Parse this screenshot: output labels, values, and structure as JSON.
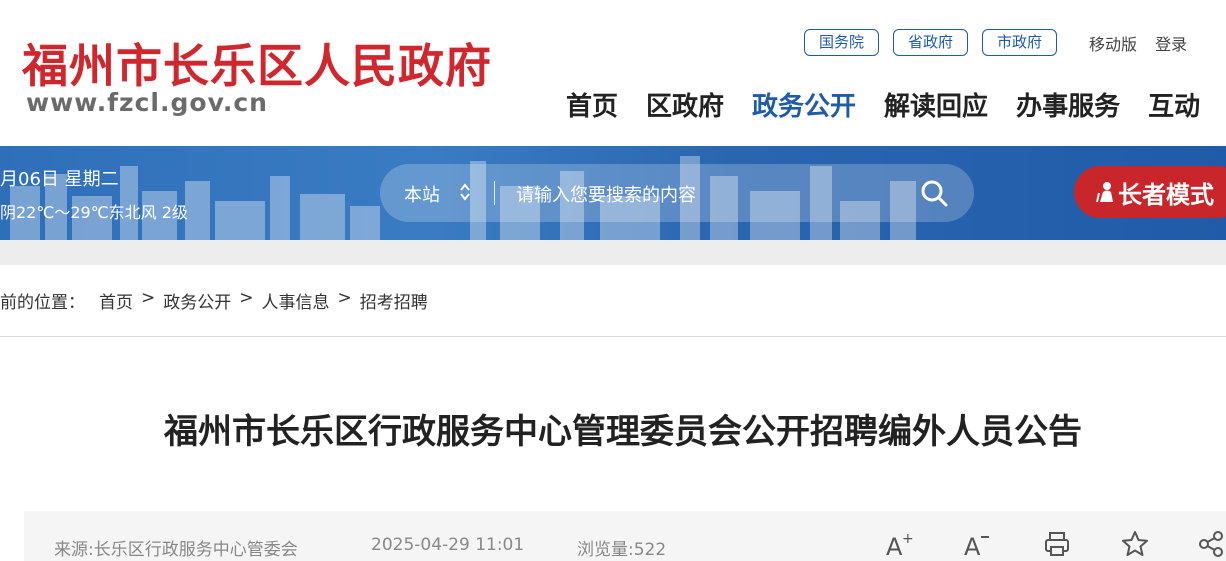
{
  "header": {
    "site_title": "福州市长乐区人民政府",
    "site_url": "www.fzcl.gov.cn",
    "top_links": {
      "guowuyuan": "国务院",
      "shengzhengfu": "省政府",
      "shizhengfu": "市政府",
      "mobile": "移动版",
      "login": "登录"
    },
    "nav": [
      "首页",
      "区政府",
      "政务公开",
      "解读回应",
      "办事服务",
      "互动"
    ],
    "active_nav_index": 2
  },
  "banner": {
    "date": "月06日 星期二",
    "weather": "阴22℃～29℃东北风 2级",
    "search_scope": "本站",
    "search_placeholder": "请输入您要搜索的内容",
    "elder_mode": "长者模式"
  },
  "breadcrumb": {
    "label": "前的位置：",
    "items": [
      "首页",
      "政务公开",
      "人事信息",
      "招考招聘"
    ],
    "separator": ">"
  },
  "article": {
    "title": "福州市长乐区行政服务中心管理委员会公开招聘编外人员公告",
    "source": "来源:长乐区行政服务中心管委会",
    "datetime": "2025-04-29 11:01",
    "views": "浏览量:522",
    "tools": {
      "font_increase": "A⁺",
      "font_decrease": "A⁻"
    }
  },
  "colors": {
    "brand_red": "#d0262d",
    "brand_blue": "#1f5ba8",
    "elder_red": "#c8262b"
  }
}
